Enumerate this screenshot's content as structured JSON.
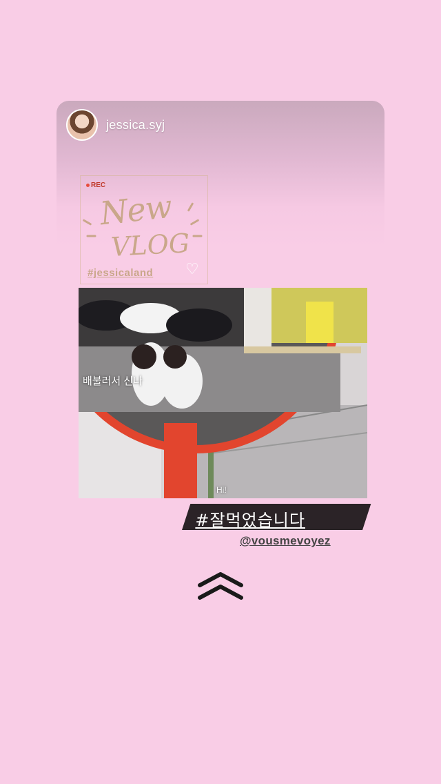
{
  "story": {
    "username": "jessica.syj",
    "sticker": {
      "rec": "REC",
      "new_text": "New",
      "vlog_text": "VLOG",
      "hashtag": "#jessicaland",
      "heart_icon": "white-heart-icon"
    },
    "video": {
      "subtitle_main": "배불러서 신나",
      "subtitle_small": "Hi!"
    },
    "korean_tag": "#잘먹었습니다",
    "mention": "@vousmevoyez",
    "swipe_icon": "chevron-double-up-icon"
  },
  "colors": {
    "background": "#f9cde6",
    "sticker_text": "#c9a78a",
    "tag_bg": "#2b2327",
    "mirror_frame": "#e2452e"
  }
}
